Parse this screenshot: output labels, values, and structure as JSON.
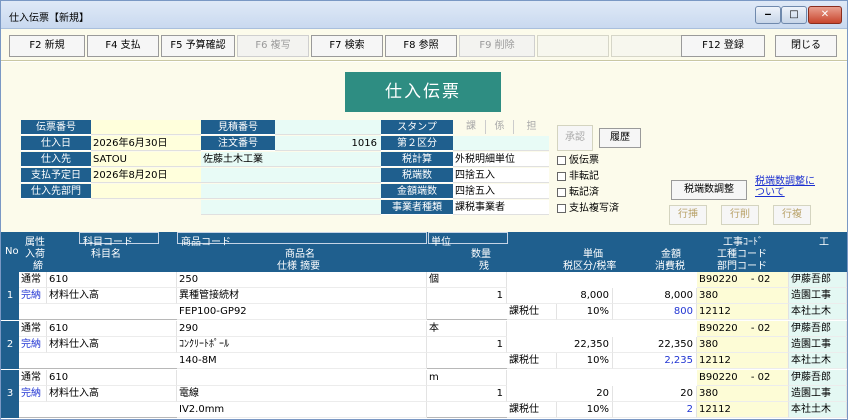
{
  "window": {
    "title": "仕入伝票【新規】"
  },
  "fkeys": [
    "F2 新規",
    "F4 支払",
    "F5 予算確認",
    "F6 複写",
    "F7 検索",
    "F8 参照",
    "F9 削除",
    "",
    "",
    "",
    "F12 登録",
    "閉じる"
  ],
  "header": {
    "title": "仕入伝票"
  },
  "form": {
    "denpyo_bango": {
      "label": "伝票番号",
      "value": ""
    },
    "mitsumori_bango": {
      "label": "見積番号",
      "value": ""
    },
    "shiire_bi": {
      "label": "仕入日",
      "value": "2026年6月30日"
    },
    "chumon_bango": {
      "label": "注文番号",
      "value": "1016"
    },
    "shiire_saki": {
      "label": "仕入先",
      "code": "SATOU",
      "name": "佐藤土木工業"
    },
    "shiharai_yotei": {
      "label": "支払予定日",
      "value": "2026年8月20日"
    },
    "shiire_saki_bumon": {
      "label": "仕入先部門",
      "value": ""
    },
    "stamp": {
      "label": "スタンプ",
      "cells": [
        "課",
        "係",
        "担"
      ]
    },
    "dai2_kubun": {
      "label": "第２区分",
      "value": ""
    },
    "zei_keisan": {
      "label": "税計算",
      "value": "外税明細単位"
    },
    "zei_hasu": {
      "label": "税端数",
      "value": "四捨五入"
    },
    "kingaku_hasu": {
      "label": "金額端数",
      "value": "四捨五入"
    },
    "jigyosha": {
      "label": "事業者種類",
      "value": "課税事業者"
    }
  },
  "approval": {
    "label": "承認",
    "history_button": "履歴"
  },
  "checks": [
    "仮伝票",
    "非転記",
    "転記済",
    "支払複写済"
  ],
  "adjust": {
    "button": "税端数調整",
    "link": "税端数調整について"
  },
  "row_buttons": [
    "行挿",
    "行削",
    "行複"
  ],
  "grid": {
    "headers": {
      "no": "No",
      "zokusei": [
        "属性",
        "入荷",
        "締"
      ],
      "kamoku_code": "科目コード",
      "kamoku_name": "科目名",
      "shohin_code": "商品コード",
      "shohin_name": "商品名",
      "shiyo": "仕様 摘要",
      "tani": "単位",
      "suryo": "数量",
      "zan": "残",
      "tanka": "単価",
      "zei": "税区分/税率",
      "kingaku": "金額",
      "shohizei": "消費税",
      "koji_code": "工事ｺｰﾄﾞ",
      "koshu_code": "工種コード",
      "bumon_code": "部門コード",
      "kouji_r": "工"
    },
    "rows": [
      {
        "no": "1",
        "zokusei": "通常",
        "nyuka": "完納",
        "kamoku_code": "610",
        "kamoku_name": "材料仕入高",
        "shohin_code": "250",
        "shohin_name": "異種管接続材",
        "shiyo": "FEP100-GP92",
        "tani": "個",
        "suryo": "1",
        "tanka": "8,000",
        "zei": "課税仕",
        "rate": "10%",
        "kingaku": "8,000",
        "tax": "800",
        "koji": "B90220　 - 02",
        "koshu": "380",
        "bumon": "12112",
        "koji_n": "伊藤吾郎",
        "koshu_n": "造園工事",
        "bumon_n": "本社土木"
      },
      {
        "no": "2",
        "zokusei": "通常",
        "nyuka": "完納",
        "kamoku_code": "610",
        "kamoku_name": "材料仕入高",
        "shohin_code": "290",
        "shohin_name": "ｺﾝｸﾘｰﾄﾎﾟｰﾙ",
        "shiyo": "140-8M",
        "tani": "本",
        "suryo": "1",
        "tanka": "22,350",
        "zei": "課税仕",
        "rate": "10%",
        "kingaku": "22,350",
        "tax": "2,235",
        "koji": "B90220　 - 02",
        "koshu": "380",
        "bumon": "12112",
        "koji_n": "伊藤吾郎",
        "koshu_n": "造園工事",
        "bumon_n": "本社土木"
      },
      {
        "no": "3",
        "zokusei": "通常",
        "nyuka": "完納",
        "kamoku_code": "610",
        "kamoku_name": "材料仕入高",
        "shohin_code": "",
        "shohin_name": "電線",
        "shiyo": "IV2.0mm",
        "tani": "m",
        "suryo": "1",
        "tanka": "20",
        "zei": "課税仕",
        "rate": "10%",
        "kingaku": "20",
        "tax": "2",
        "koji": "B90220　 - 02",
        "koshu": "380",
        "bumon": "12112",
        "koji_n": "伊藤吾郎",
        "koshu_n": "造園工事",
        "bumon_n": "本社土木"
      }
    ]
  }
}
